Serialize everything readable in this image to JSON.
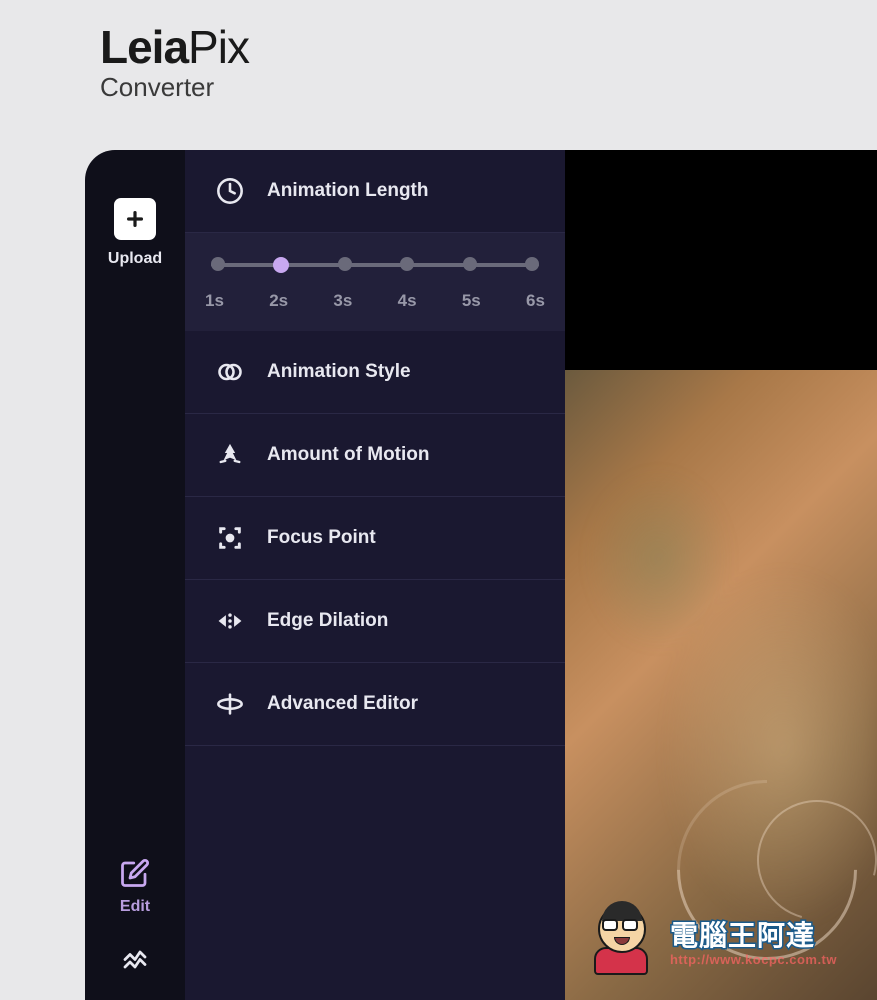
{
  "brand": {
    "name_bold": "Leia",
    "name_light": "Pix",
    "subtitle": "Converter"
  },
  "sidebar": {
    "upload_label": "Upload",
    "edit_label": "Edit"
  },
  "settings": {
    "animation_length": {
      "title": "Animation Length",
      "selected_index": 1,
      "options": [
        "1s",
        "2s",
        "3s",
        "4s",
        "5s",
        "6s"
      ]
    },
    "animation_style": {
      "title": "Animation Style"
    },
    "amount_of_motion": {
      "title": "Amount of Motion"
    },
    "focus_point": {
      "title": "Focus Point"
    },
    "edge_dilation": {
      "title": "Edge Dilation"
    },
    "advanced_editor": {
      "title": "Advanced Editor"
    }
  },
  "watermark": {
    "text": "電腦王阿達",
    "url": "http://www.kocpc.com.tw"
  }
}
